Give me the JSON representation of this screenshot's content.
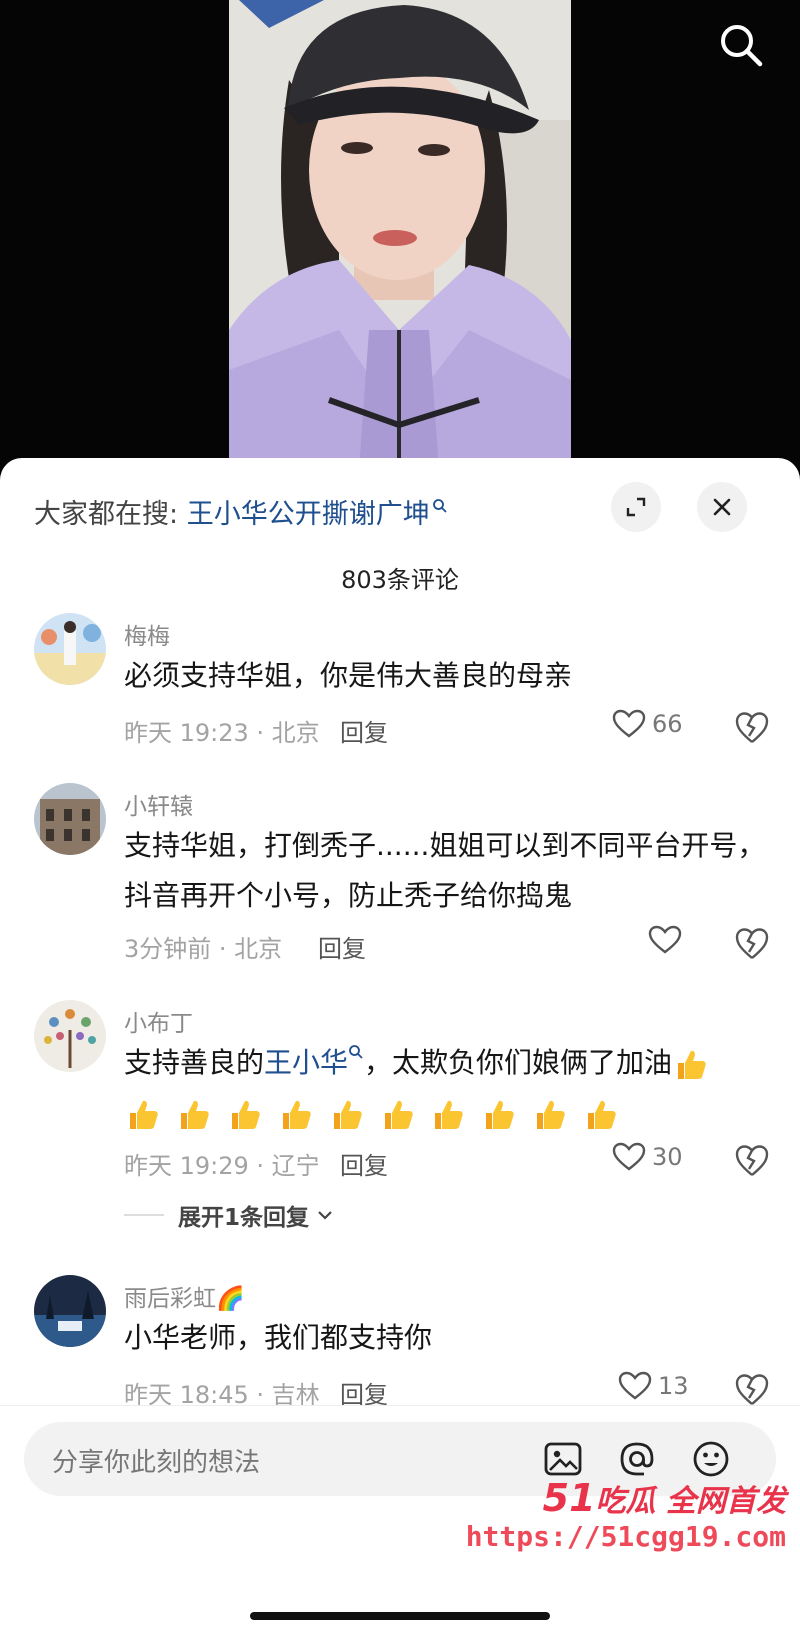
{
  "search_hint": {
    "prefix": "大家都在搜:",
    "query": "王小华公开撕谢广坤"
  },
  "comment_count": "803条评论",
  "comments": [
    {
      "user": "梅梅",
      "text": "必须支持华姐，你是伟大善良的母亲",
      "time": "昨天 19:23 · 北京",
      "reply": "回复",
      "likes": "66"
    },
    {
      "user": "小轩辕",
      "text": "支持华姐，打倒秃子......姐姐可以到不同平台开号，抖音再开个小号，防止秃子给你捣鬼",
      "time": "3分钟前 · 北京",
      "reply": "回复",
      "likes": ""
    },
    {
      "user": "小布丁",
      "text_prefix": "支持善良的",
      "text_link": "王小华",
      "text_suffix": "，太欺负你们娘俩了加油",
      "thumb_count": 11,
      "time": "昨天 19:29 · 辽宁",
      "reply": "回复",
      "likes": "30",
      "expand": "展开1条回复"
    },
    {
      "user": "雨后彩虹🌈",
      "text": "小华老师，我们都支持你",
      "time": "昨天 18:45 · 吉林",
      "reply": "回复",
      "likes": "13"
    }
  ],
  "input_placeholder": "分享你此刻的想法",
  "watermark": {
    "brand_num": "51",
    "brand_text": "吃瓜 全网首发",
    "url": "https://51cgg19.com"
  },
  "icons": [
    "search-icon",
    "expand-icon",
    "close-icon",
    "heart-icon",
    "dislike-icon",
    "image-icon",
    "at-icon",
    "emoji-icon",
    "chevron-down-icon",
    "thumbs-up-icon"
  ],
  "colors": {
    "link": "#1f4f8f",
    "watermark": "#e8334a",
    "sheet_bg": "#ffffff"
  }
}
